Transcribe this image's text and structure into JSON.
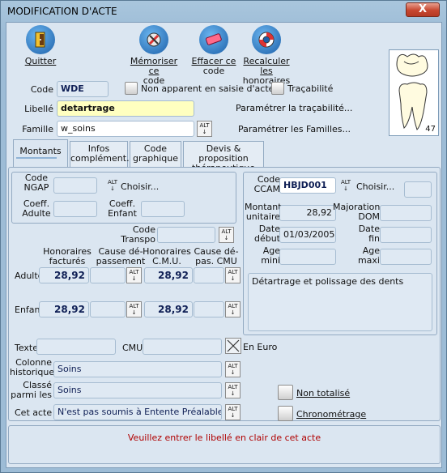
{
  "window": {
    "title": "MODIFICATION D'ACTE",
    "close": "X"
  },
  "toolbar": {
    "quit": "Quitter",
    "memorize_1": "Mémoriser ce",
    "memorize_2": "code",
    "erase_1": "Effacer ce",
    "erase_2": "code",
    "recalc_1": "Recalculer les",
    "recalc_2": "honoraires"
  },
  "header": {
    "code_label": "Code",
    "code_value": "WDE",
    "not_shown_label": "Non apparent en saisie d'actes",
    "traceability_label": "Traçabilité",
    "libelle_label": "Libellé",
    "libelle_value": "detartrage",
    "traceability_settings": "Paramétrer la traçabilité...",
    "famille_label": "Famille",
    "famille_value": "w_soins",
    "families_settings": "Paramétrer les Familles...",
    "tooth_number": "47"
  },
  "tabs": {
    "t1": "Montants",
    "t2a": "Infos",
    "t2b": "complément.",
    "t3a": "Code",
    "t3b": "graphique",
    "t4a": "Devis & proposition",
    "t4b": "thérapeutique"
  },
  "ngap": {
    "code_a": "Code",
    "code_b": "NGAP",
    "choose": "Choisir...",
    "coeff_adulte_a": "Coeff.",
    "coeff_adulte_b": "Adulte",
    "coeff_enfant_a": "Coeff.",
    "coeff_enfant_b": "Enfant"
  },
  "transpo": {
    "a": "Code",
    "b": "Transpo"
  },
  "fees": {
    "h1a": "Honoraires",
    "h1b": "facturés",
    "h2a": "Cause dé-",
    "h2b": "passement",
    "h3a": "Honoraires",
    "h3b": "C.M.U.",
    "h4a": "Cause dé-",
    "h4b": "pas. CMU",
    "adulte_label": "Adulte",
    "adulte_fee": "28,92",
    "adulte_cmu": "28,92",
    "enfant_label": "Enfant",
    "enfant_fee": "28,92",
    "enfant_cmu": "28,92"
  },
  "ccam": {
    "code_a": "Code",
    "code_b": "CCAM",
    "code_value": "HBJD001",
    "choose": "Choisir...",
    "montant_a": "Montant",
    "montant_b": "unitaire",
    "montant_value": "28,92",
    "majoration_a": "Majoration",
    "majoration_b": "DOM",
    "date_debut_a": "Date",
    "date_debut_b": "début",
    "date_debut_value": "01/03/2005",
    "date_fin_a": "Date",
    "date_fin_b": "fin",
    "age_mini_a": "Age",
    "age_mini_b": "mini",
    "age_maxi_a": "Age",
    "age_maxi_b": "maxi",
    "description": "Détartrage et polissage des dents"
  },
  "bottom": {
    "texte_label": "Texte",
    "cmu_label": "CMU",
    "euro_label": "En Euro",
    "colonne_a": "Colonne",
    "colonne_b": "historique",
    "colonne_value": "Soins",
    "classe_a": "Classé",
    "classe_b": "parmi les",
    "classe_value": "Soins",
    "cetacte_label": "Cet acte",
    "cetacte_value": "N'est pas soumis à Entente Préalable",
    "non_totalise": "Non totalisé",
    "chronometrage": "Chronométrage"
  },
  "status": {
    "s1": "Veuillez entrer le ",
    "s2": "libellé",
    "s3": " en clair de cet acte"
  },
  "alt_glyph": "ALT",
  "colors": {
    "accent": "#0f1f55",
    "status_red": "#b00000",
    "libelle_bg": "#ffffc0"
  }
}
